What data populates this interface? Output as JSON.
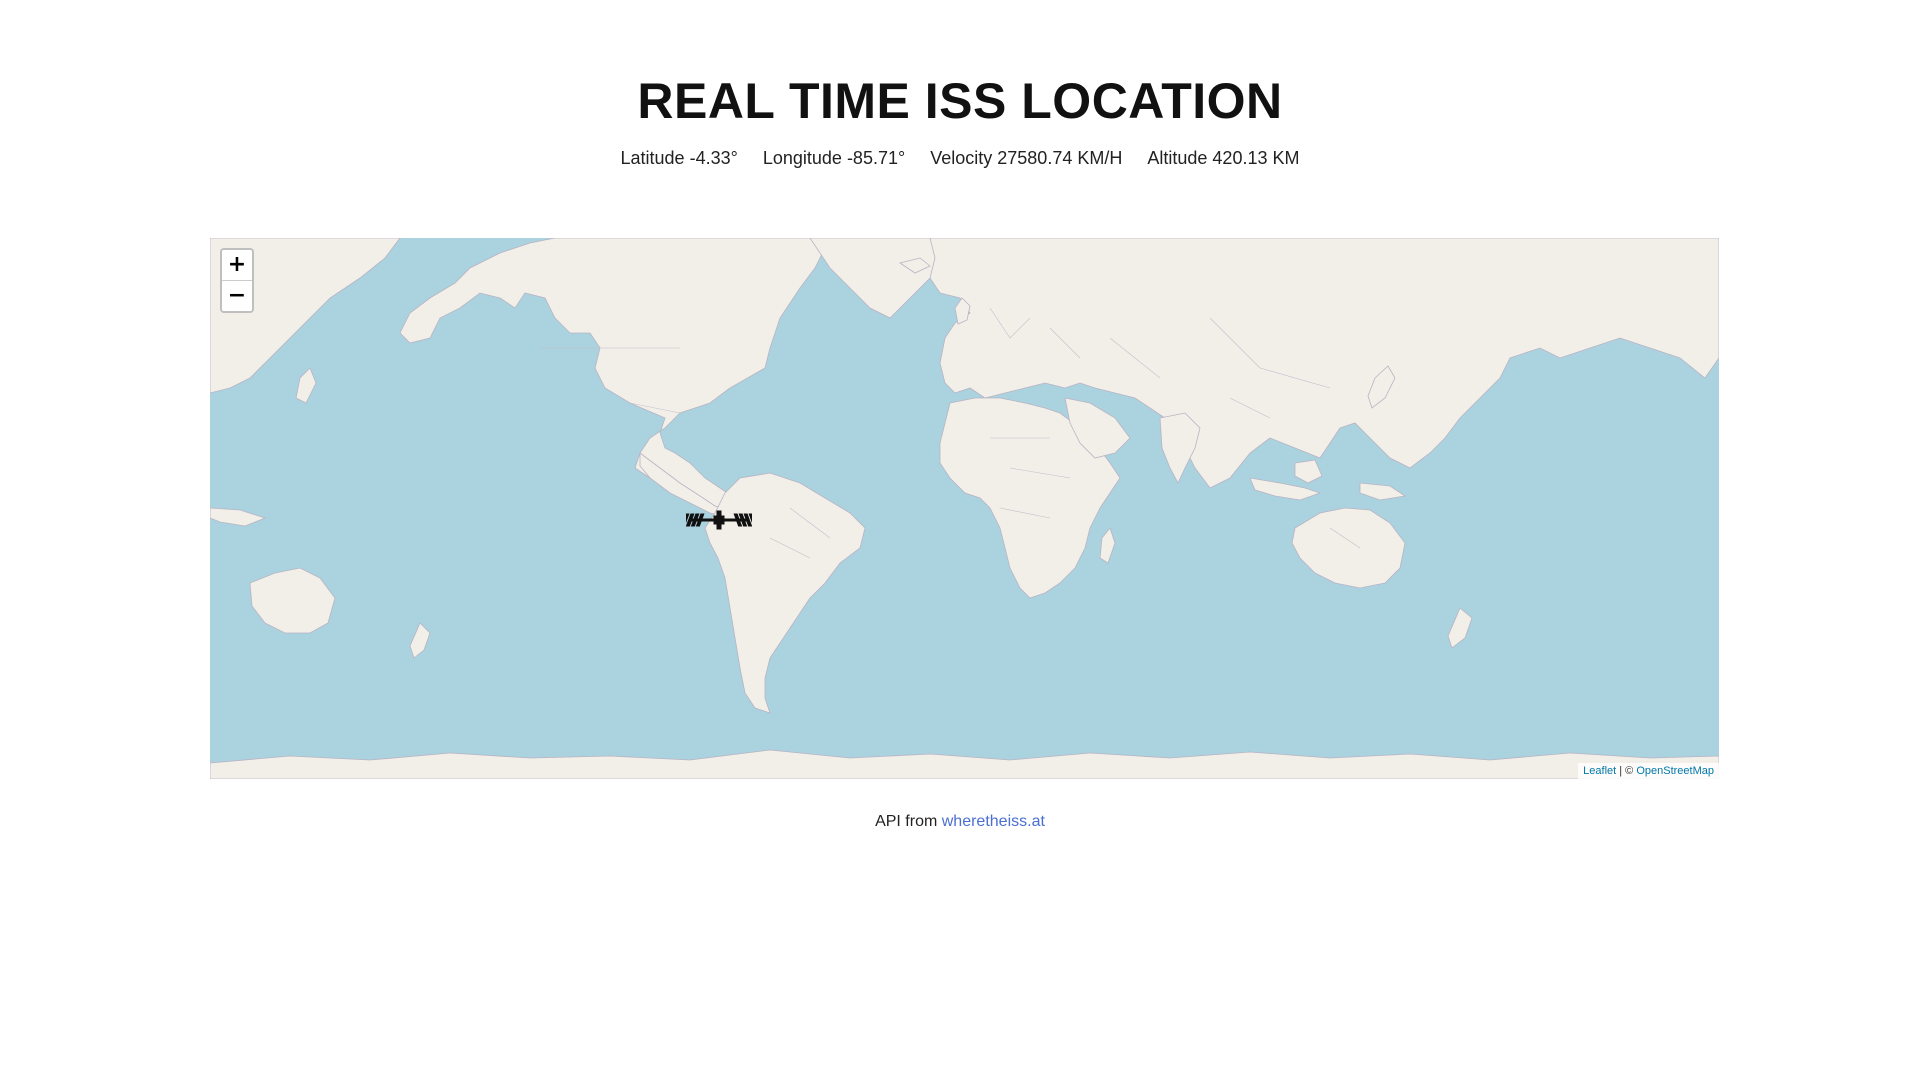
{
  "header": {
    "title": "REAL TIME ISS LOCATION"
  },
  "stats": {
    "latitude_label": "Latitude",
    "latitude_value": "-4.33°",
    "longitude_label": "Longitude",
    "longitude_value": "-85.71°",
    "velocity_label": "Velocity",
    "velocity_value": "27580.74 KM/H",
    "altitude_label": "Altitude",
    "altitude_value": "420.13 KM"
  },
  "map": {
    "zoom_in": "+",
    "zoom_out": "−",
    "attribution_leaflet": "Leaflet",
    "attribution_sep": " | © ",
    "attribution_osm": "OpenStreetMap",
    "marker_icon": "iss-icon",
    "marker_lat": -4.33,
    "marker_lon": -85.71,
    "colors": {
      "water": "#aad3df",
      "land": "#f2efe9",
      "border": "#b9b3c3"
    }
  },
  "footer": {
    "prefix": "API from ",
    "link_text": "wheretheiss.at"
  }
}
